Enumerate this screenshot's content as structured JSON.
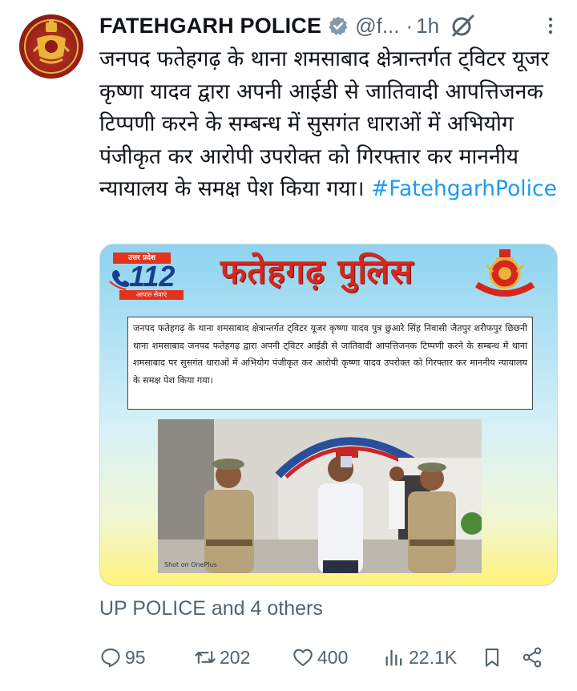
{
  "tweet": {
    "author_name": "FATEHGARH POLICE",
    "handle": "@f...",
    "separator": "·",
    "time": "1h",
    "text": "जनपद फतेहगढ़ के थाना शमसाबाद क्षेत्रान्तर्गत ट्विटर यूजर कृष्णा यादव द्वारा अपनी आईडी से जातिवादी आपत्तिजनक टिप्पणी करने के सम्बन्ध में सुसगंत धाराओं में अभियोग पंजीकृत कर आरोपी उपरोक्त को गिरफ्तार कर माननीय न्यायालय के समक्ष पेश किया गया।",
    "hashtag": "#FatehgarhPolice"
  },
  "media": {
    "badge_top": "उत्तर प्रदेश",
    "badge_number": "112",
    "badge_bottom": "आपात सेवाएं",
    "title": "फतेहगढ़ पुलिस",
    "notice": "जनपद फतेहगढ़ के थाना शमसाबाद क्षेत्रान्तर्गत ट्विटर यूजर कृष्णा यादव पुत्र छुआरे सिंह निवासी जैतपुर शरीफपुर छिछनी थाना शमसाबाद जनपद फतेहगढ़ द्वारा अपनी ट्विटर आईडी से जातिवादी आपत्तिजनक टिप्पणी करने के सम्बन्ध में थाना शमसाबाद पर सुसगंत धाराओं में अभियोग पंजीकृत कर आरोपी कृष्णा यादव उपरोक्त को गिरफ्तार कर माननीय न्यायालय के समक्ष पेश किया गया।",
    "photo_credit": "Shot on OnePlus"
  },
  "social_context": "UP POLICE and 4 others",
  "actions": {
    "replies": "95",
    "reposts": "202",
    "likes": "400",
    "views": "22.1K"
  },
  "colors": {
    "accent": "#1d9bf0",
    "secondary_text": "#536471",
    "primary_text": "#0f1419",
    "title_red": "#d7261b"
  },
  "icons": [
    "verified-badge-icon",
    "grok-icon",
    "more-options-icon",
    "reply-icon",
    "repost-icon",
    "like-icon",
    "views-icon",
    "bookmark-icon",
    "share-icon"
  ]
}
